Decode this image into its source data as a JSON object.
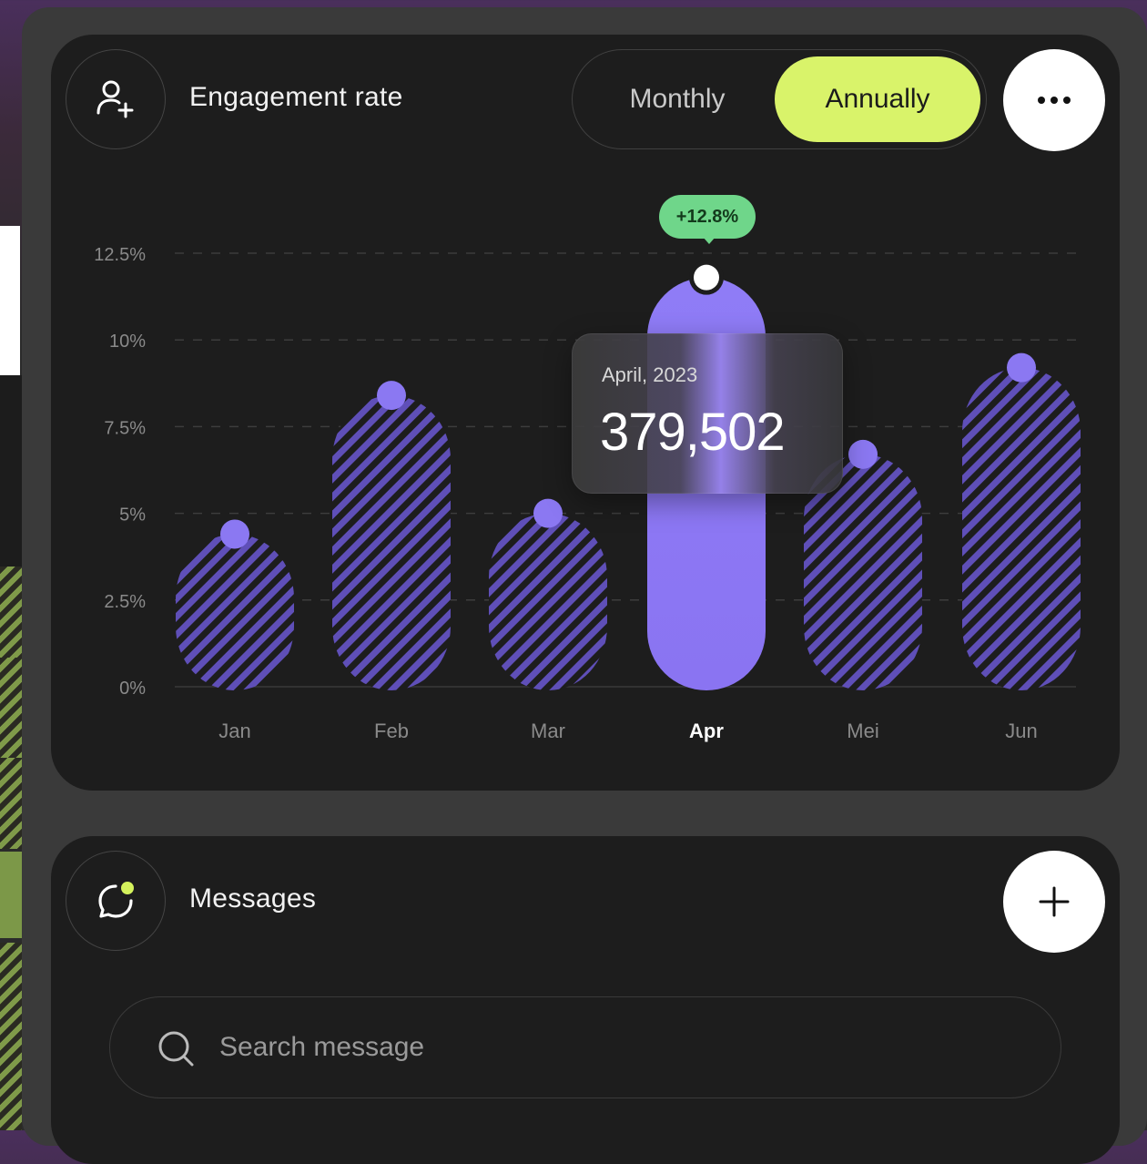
{
  "engagement": {
    "title": "Engagement rate",
    "icon": "user-plus-icon",
    "toggle": {
      "monthly": "Monthly",
      "annually": "Annually",
      "selected": "Annually"
    },
    "more_icon": "more-horizontal-icon",
    "tooltip": {
      "date": "April, 2023",
      "value": "379,502",
      "change": "+12.8%"
    }
  },
  "chart_data": {
    "type": "bar",
    "categories": [
      "Jan",
      "Feb",
      "Mar",
      "Apr",
      "Mei",
      "Jun"
    ],
    "values": [
      4.4,
      8.4,
      5.0,
      11.8,
      6.7,
      9.2
    ],
    "highlighted": "Apr",
    "ylim": [
      0,
      12.5
    ],
    "yticks": [
      "0%",
      "2.5%",
      "5%",
      "7.5%",
      "10%",
      "12.5%"
    ],
    "grid": true,
    "colors": {
      "bar": "#8b78f2",
      "hatch": "#5f4fb8",
      "highlight": "#8b78f2",
      "axis_text": "#8a8a8a",
      "active_label": "#ffffff"
    }
  },
  "messages": {
    "title": "Messages",
    "icon": "chat-bubble-icon",
    "add_icon": "plus-icon",
    "search_placeholder": "Search message",
    "search_icon": "search-icon"
  }
}
